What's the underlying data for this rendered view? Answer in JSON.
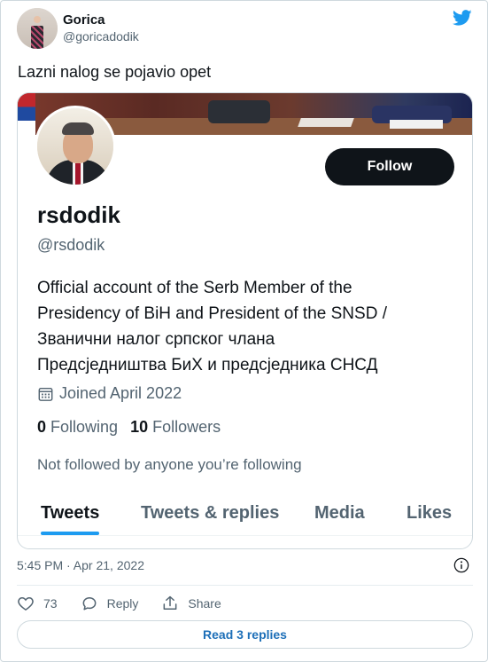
{
  "tweet": {
    "author_name": "Gorica",
    "author_handle": "@goricadodik",
    "text": "Lazni nalog se pojavio opet",
    "timestamp": "5:45 PM · Apr 21, 2022"
  },
  "embedded_profile": {
    "name": "rsdodik",
    "handle": "@rsdodik",
    "follow_label": "Follow",
    "bio_lines": [
      "Official account of the Serb Member of the",
      "Presidency of BiH and President of the SNSD /",
      "Званични налог српског члана",
      "Предсједништва БиХ и предсједника СНСД"
    ],
    "joined": "Joined April 2022",
    "following_count": "0",
    "following_label": "Following",
    "followers_count": "10",
    "followers_label": "Followers",
    "not_followed_text": "Not followed by anyone you’re following",
    "tabs": [
      "Tweets",
      "Tweets & replies",
      "Media",
      "Likes"
    ]
  },
  "actions": {
    "like_count": "73",
    "reply_label": "Reply",
    "share_label": "Share",
    "read_replies_label": "Read 3 replies"
  },
  "colors": {
    "accent": "#1d9bf0",
    "follow_button": "#0f1419",
    "muted_text": "#536471"
  },
  "icons": [
    "twitter-logo-icon",
    "calendar-icon",
    "info-icon",
    "heart-icon",
    "reply-icon",
    "share-icon"
  ]
}
